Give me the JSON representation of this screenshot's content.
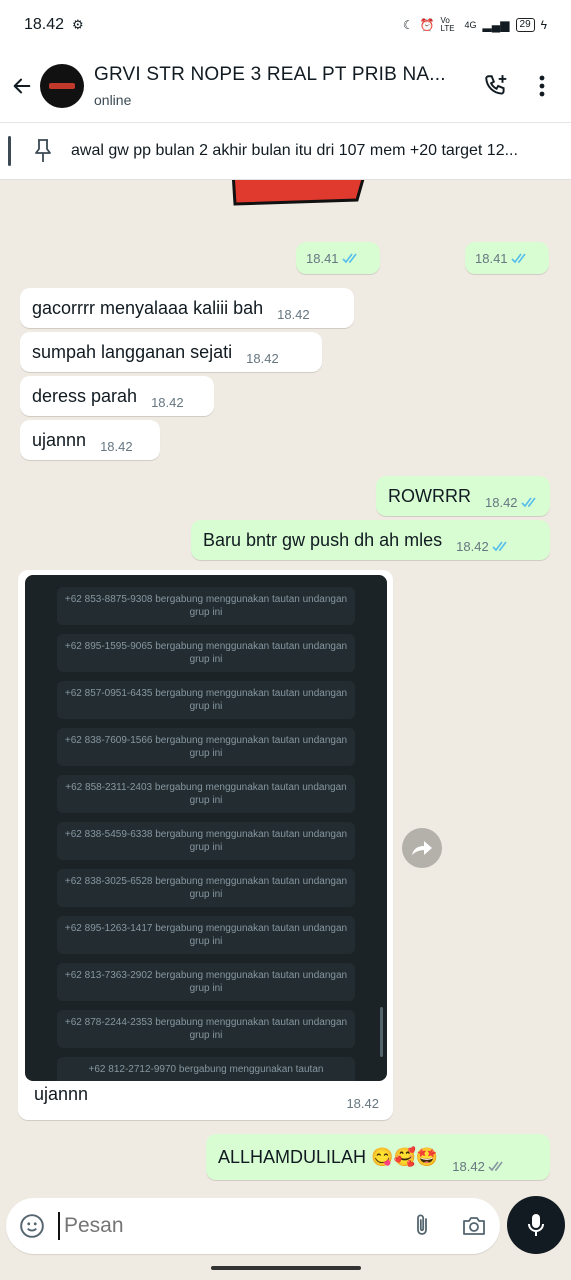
{
  "status": {
    "time": "18.42",
    "network": "4G",
    "volte": "Vo LTE",
    "battery": "29"
  },
  "header": {
    "title": "GRVI STR NOPE 3 REAL PT PRIB NA...",
    "subtitle": "online"
  },
  "pinned": {
    "text": "awal gw pp bulan 2 akhir bulan itu dri 107 mem +20 target 12..."
  },
  "messages": [
    {
      "text": "",
      "time": "18.41"
    },
    {
      "text": "",
      "time": "18.41"
    },
    {
      "text": "gacorrrr menyalaaa kaliii bah",
      "time": "18.42"
    },
    {
      "text": "sumpah langganan sejati",
      "time": "18.42"
    },
    {
      "text": "deress parah",
      "time": "18.42"
    },
    {
      "text": "ujannn",
      "time": "18.42"
    },
    {
      "text": "ROWRRR",
      "time": "18.42"
    },
    {
      "text": "Baru bntr gw push dh ah mles",
      "time": "18.42"
    },
    {
      "text": "ALLHAMDULILAH 😋🥰🤩",
      "time": "18.42"
    }
  ],
  "image_message": {
    "caption": "ujannn",
    "time": "18.42",
    "system_lines": [
      {
        "number": "+62 853-8875-9308",
        "text": "bergabung menggunakan tautan undangan grup ini"
      },
      {
        "number": "+62 895-1595-9065",
        "text": "bergabung menggunakan tautan undangan grup ini"
      },
      {
        "number": "+62 857-0951-6435",
        "text": "bergabung menggunakan tautan undangan grup ini"
      },
      {
        "number": "+62 838-7609-1566",
        "text": "bergabung menggunakan tautan undangan grup ini"
      },
      {
        "number": "+62 858-2311-2403",
        "text": "bergabung menggunakan tautan undangan grup ini"
      },
      {
        "number": "+62 838-5459-6338",
        "text": "bergabung menggunakan tautan undangan grup ini"
      },
      {
        "number": "+62 838-3025-6528",
        "text": "bergabung menggunakan tautan undangan grup ini"
      },
      {
        "number": "+62 895-1263-1417",
        "text": "bergabung menggunakan tautan undangan grup ini"
      },
      {
        "number": "+62 813-7363-2902",
        "text": "bergabung menggunakan tautan undangan grup ini"
      },
      {
        "number": "+62 878-2244-2353",
        "text": "bergabung menggunakan tautan undangan grup ini"
      },
      {
        "number": "+62 812-2712-9970",
        "text": "bergabung menggunakan tautan"
      }
    ]
  },
  "composer": {
    "placeholder": "Pesan"
  },
  "colors": {
    "chat_bg": "#efeae2",
    "outgoing": "#d9fdd3",
    "incoming": "#ffffff",
    "read_tick": "#53bdeb",
    "sent_tick": "#8696a0"
  }
}
